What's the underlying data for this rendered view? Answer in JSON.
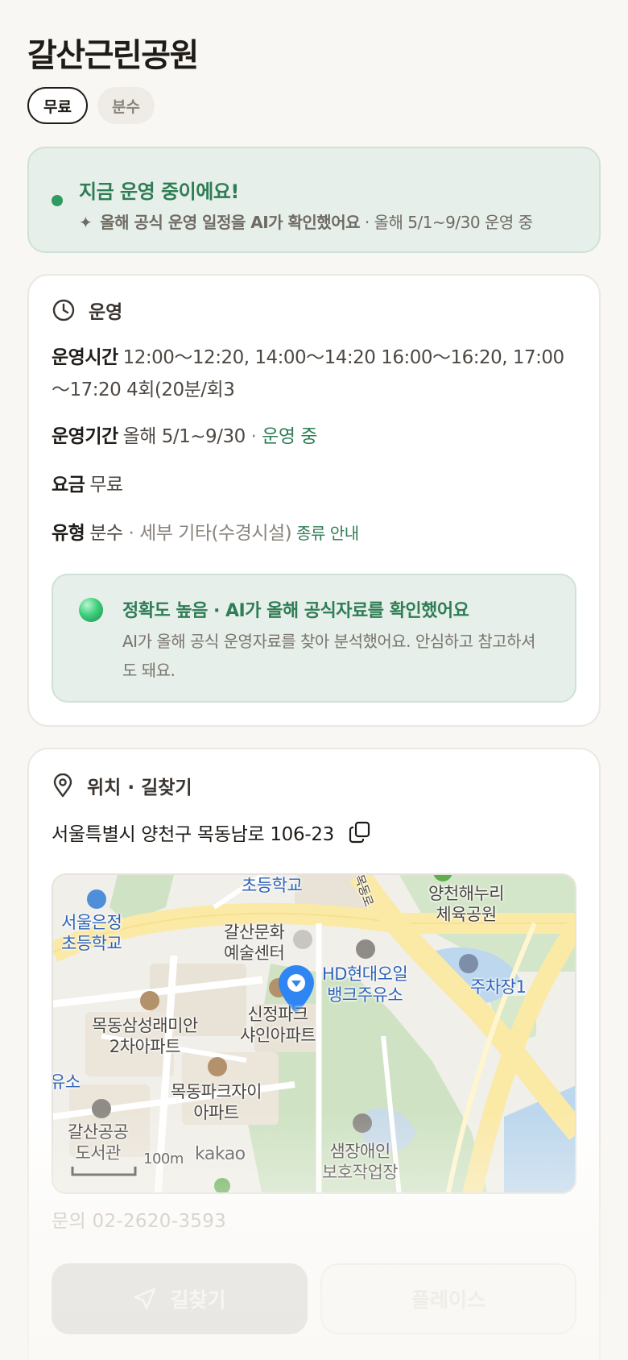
{
  "place": {
    "title": "갈산근린공원",
    "chips": [
      {
        "label": "무료",
        "active": true
      },
      {
        "label": "분수",
        "active": false
      }
    ]
  },
  "status": {
    "title": "지금 운영 중이에요!",
    "ai_note_strong": "올해 공식 운영 일정을 AI가 확인했어요",
    "ai_note_rest": " · 올해 5/1~9/30 운영 중",
    "accent": "#2f9a62"
  },
  "operation": {
    "section_title": "운영",
    "hours_label": "운영시간",
    "hours_value": "12:00～12:20, 14:00～14:20 16:00～16:20, 17:00～17:20 4회(20분/회3",
    "period_label": "운영기간",
    "period_value": "올해 5/1~9/30",
    "period_sep": " · ",
    "period_status": "운영 중",
    "fee_label": "요금",
    "fee_value": "무료",
    "type_label": "유형",
    "type_value": "분수",
    "type_detail": " · 세부 기타(수경시설)",
    "type_link": "종류 안내",
    "accuracy_title": "정확도 높음 · AI가 올해 공식자료를 확인했어요",
    "accuracy_desc": "AI가 올해 공식 운영자료를 찾아 분석했어요. 안심하고 참고하셔도 돼요."
  },
  "location": {
    "section_title": "위치 · 길찾기",
    "address": "서울특별시 양천구 목동남로 106-23",
    "map_labels": {
      "school_top": "초등학교",
      "road": "목동로",
      "school_left_1": "서울은정",
      "school_left_2": "초등학교",
      "culture_1": "갈산문화",
      "culture_2": "예술센터",
      "sports_1": "양천해누리",
      "sports_2": "체육공원",
      "gas_1": "HD현대오일",
      "gas_2": "뱅크주유소",
      "parking": "주차장1",
      "apt1_1": "목동삼성래미안",
      "apt1_2": "2차아파트",
      "apt2_1": "신정파크",
      "apt2_2": "샤인아파트",
      "gas_left": "유소",
      "apt3_1": "목동파크자이",
      "apt3_2": "아파트",
      "library_1": "갈산공공",
      "library_2": "도서관",
      "center_1": "샘장애인",
      "center_2": "보호작업장",
      "scale": "100m",
      "brand": "kakao"
    },
    "inquiry": "문의 02-2620-3593",
    "route_label": "길찾기",
    "place_label": "플레이스"
  }
}
